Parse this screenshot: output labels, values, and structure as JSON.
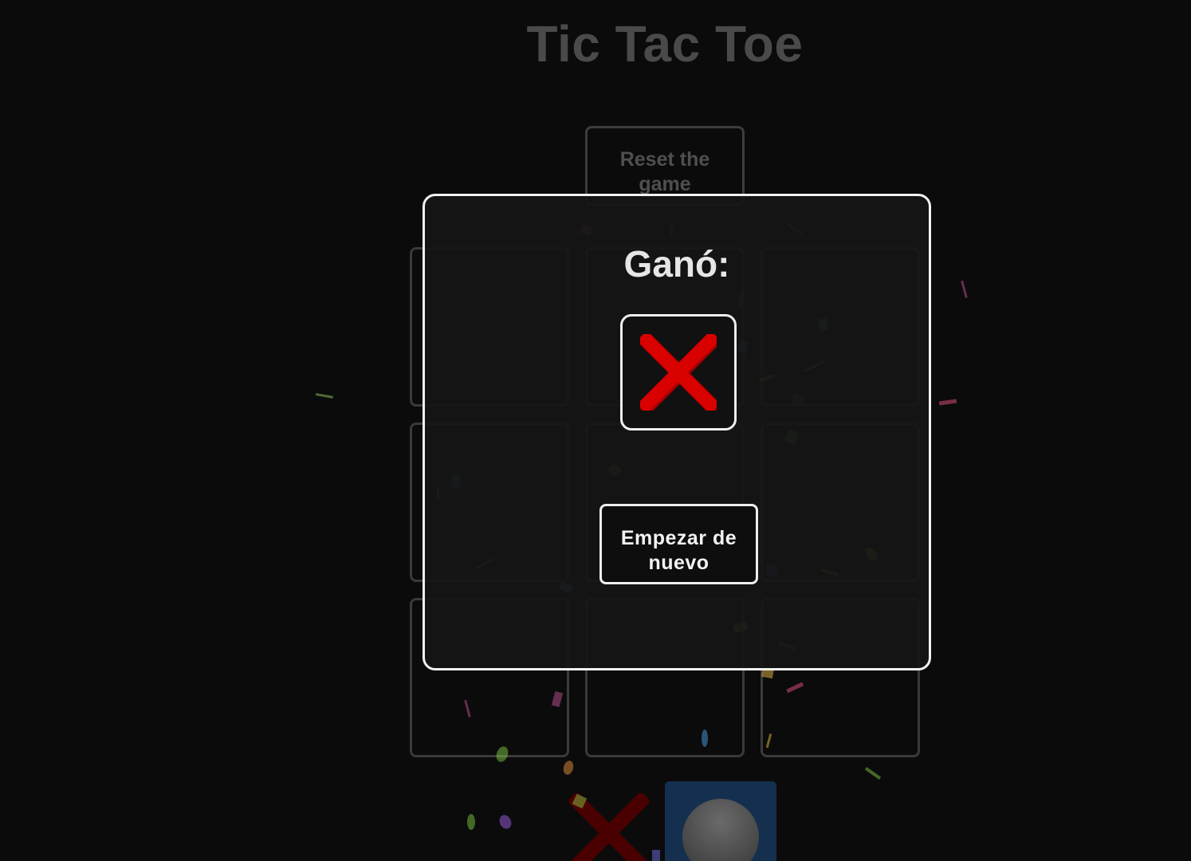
{
  "game": {
    "title": "Tic Tac Toe",
    "reset_label": "Reset the game",
    "board": [
      "",
      "",
      "",
      "",
      "",
      "",
      "",
      "",
      ""
    ],
    "turn_indicator": {
      "x_icon": "x-mark-icon",
      "o_icon": "o-disc-icon",
      "active": "O"
    }
  },
  "modal": {
    "title": "Ganó:",
    "winner": "X",
    "winner_icon": "x-mark-icon",
    "restart_label": "Empezar de nuevo"
  },
  "colors": {
    "background": "#0b0b0b",
    "x_red": "#d90000",
    "o_panel": "#15304f",
    "modal_border": "#f1f1f1"
  }
}
